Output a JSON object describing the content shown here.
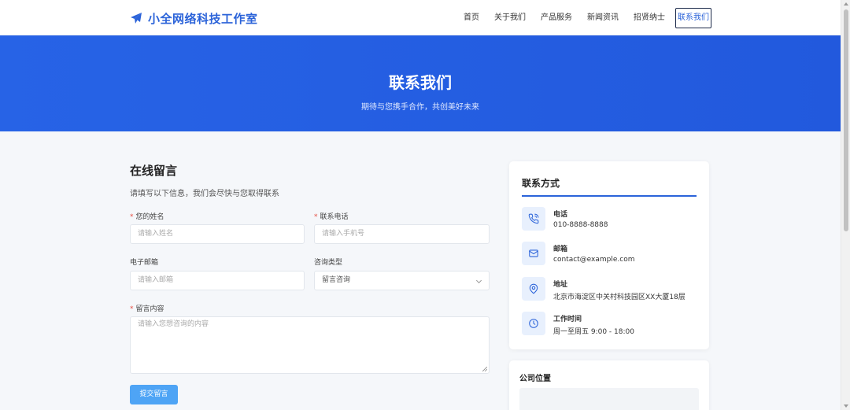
{
  "header": {
    "brand_name": "小全网络科技工作室",
    "nav": [
      "首页",
      "关于我们",
      "产品服务",
      "新闻资讯",
      "招贤纳士",
      "联系我们"
    ],
    "active_nav": "联系我们"
  },
  "hero": {
    "title": "联系我们",
    "subtitle": "期待与您携手合作，共创美好未来"
  },
  "form": {
    "title": "在线留言",
    "description": "请填写以下信息，我们会尽快与您取得联系",
    "name_label": "您的姓名",
    "name_placeholder": "请输入姓名",
    "phone_label": "联系电话",
    "phone_placeholder": "请输入手机号",
    "email_label": "电子邮箱",
    "email_placeholder": "请输入邮箱",
    "type_label": "咨询类型",
    "type_value": "留言咨询",
    "message_label": "留言内容",
    "message_placeholder": "请输入您想咨询的内容",
    "submit_label": "提交留言"
  },
  "contact": {
    "title": "联系方式",
    "items": [
      {
        "icon": "phone-icon",
        "label": "电话",
        "value": "010-8888-8888"
      },
      {
        "icon": "mail-icon",
        "label": "邮箱",
        "value": "contact@example.com"
      },
      {
        "icon": "location-pin-icon",
        "label": "地址",
        "value": "北京市海淀区中关村科技园区XX大厦18层"
      },
      {
        "icon": "clock-icon",
        "label": "工作时间",
        "value": "周一至周五 9:00 - 18:00"
      }
    ]
  },
  "location": {
    "title": "公司位置"
  },
  "colors": {
    "primary": "#2b63d9",
    "hero": "#2763e6",
    "button": "#4ea4f5",
    "required": "#e54d42"
  }
}
